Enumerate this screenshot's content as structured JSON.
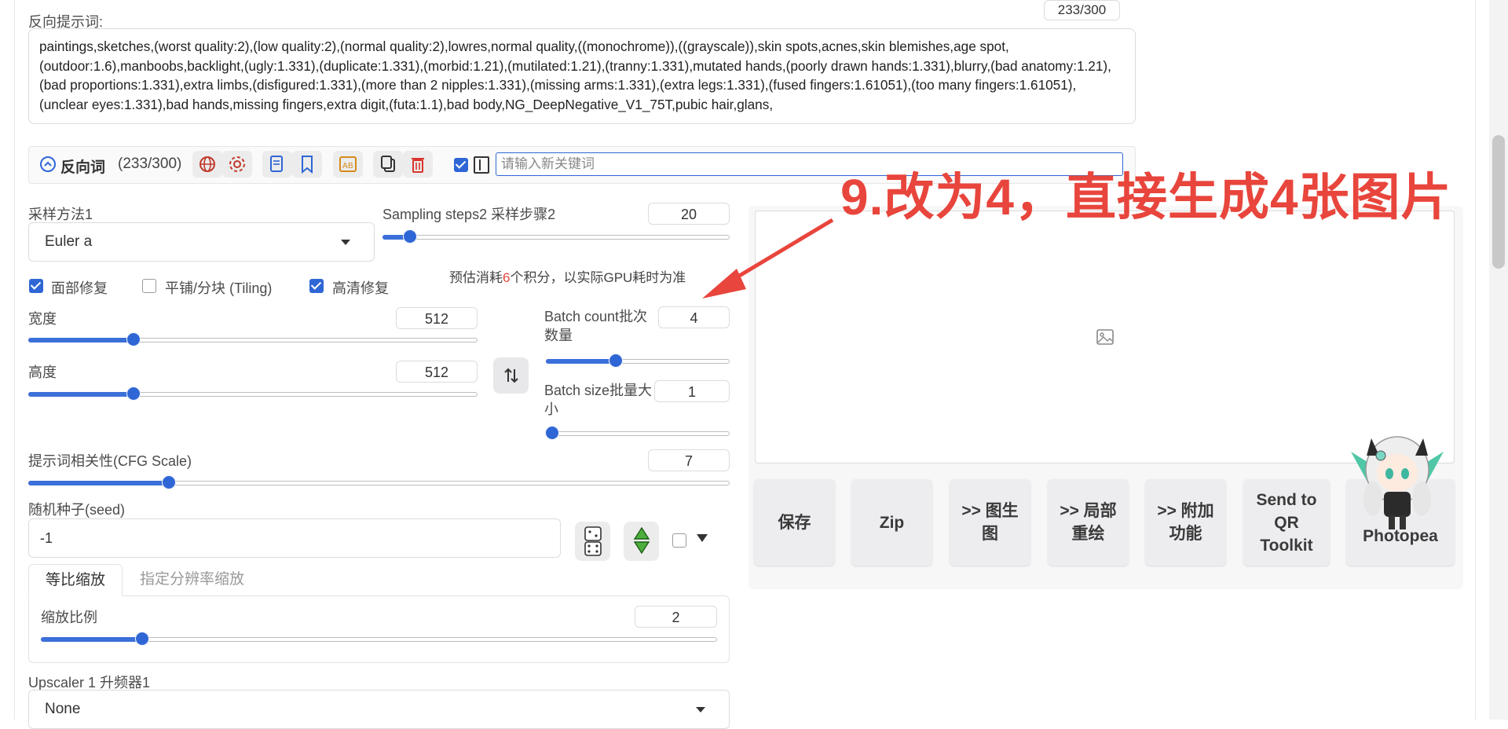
{
  "negative_prompt": {
    "label": "反向提示词:",
    "counter": "233/300",
    "text": "paintings,sketches,(worst quality:2),(low quality:2),(normal quality:2),lowres,normal quality,((monochrome)),((grayscale)),skin spots,acnes,skin blemishes,age spot,(outdoor:1.6),manboobs,backlight,(ugly:1.331),(duplicate:1.331),(morbid:1.21),(mutilated:1.21),(tranny:1.331),mutated hands,(poorly drawn hands:1.331),blurry,(bad anatomy:1.21),(bad proportions:1.331),extra limbs,(disfigured:1.331),(more than 2 nipples:1.331),(missing arms:1.331),(extra legs:1.331),(fused fingers:1.61051),(too many fingers:1.61051),(unclear eyes:1.331),bad hands,missing fingers,extra digit,(futa:1.1),bad body,NG_DeepNegative_V1_75T,pubic hair,glans,"
  },
  "toolbar": {
    "title": "反向词",
    "count": "(233/300)",
    "keyword_placeholder": "请输入新关键词"
  },
  "sampler": {
    "label": "采样方法1",
    "value": "Euler a"
  },
  "steps": {
    "label": "Sampling steps2 采样步骤2",
    "value": "20",
    "fraction": 0.08
  },
  "checkboxes": [
    {
      "label": "面部修复",
      "checked": true
    },
    {
      "label": "平铺/分块 (Tiling)",
      "checked": false
    },
    {
      "label": "高清修复",
      "checked": true
    }
  ],
  "cost_note": {
    "prefix": "预估消耗",
    "amount": "6",
    "suffix": "个积分，以实际GPU耗时为准"
  },
  "width": {
    "label": "宽度",
    "value": "512",
    "fraction": 0.235
  },
  "height": {
    "label": "高度",
    "value": "512",
    "fraction": 0.235
  },
  "batch_count": {
    "label": "Batch count批次数量",
    "value": "4",
    "fraction": 0.38
  },
  "batch_size": {
    "label": "Batch size批量大小",
    "value": "1",
    "fraction": 0.0
  },
  "cfg": {
    "label": "提示词相关性(CFG Scale)",
    "value": "7",
    "fraction": 0.2
  },
  "seed": {
    "label": "随机种子(seed)",
    "value": "-1"
  },
  "scale_tabs": [
    "等比缩放",
    "指定分辨率缩放"
  ],
  "scale_ratio": {
    "label": "缩放比例",
    "value": "2",
    "fraction": 0.15
  },
  "upscaler": {
    "label": "Upscaler 1 升频器1",
    "value": "None"
  },
  "annotation": "9.改为4，直接生成4张图片",
  "output_buttons": [
    "保存",
    "Zip",
    ">> 图生图",
    ">> 局部重绘",
    ">> 附加功能",
    "Send to QR Toolkit",
    "Photopea"
  ],
  "colors": {
    "accent": "#2f66d6",
    "annotation": "#e8453c",
    "highlight": "#e8453c"
  }
}
